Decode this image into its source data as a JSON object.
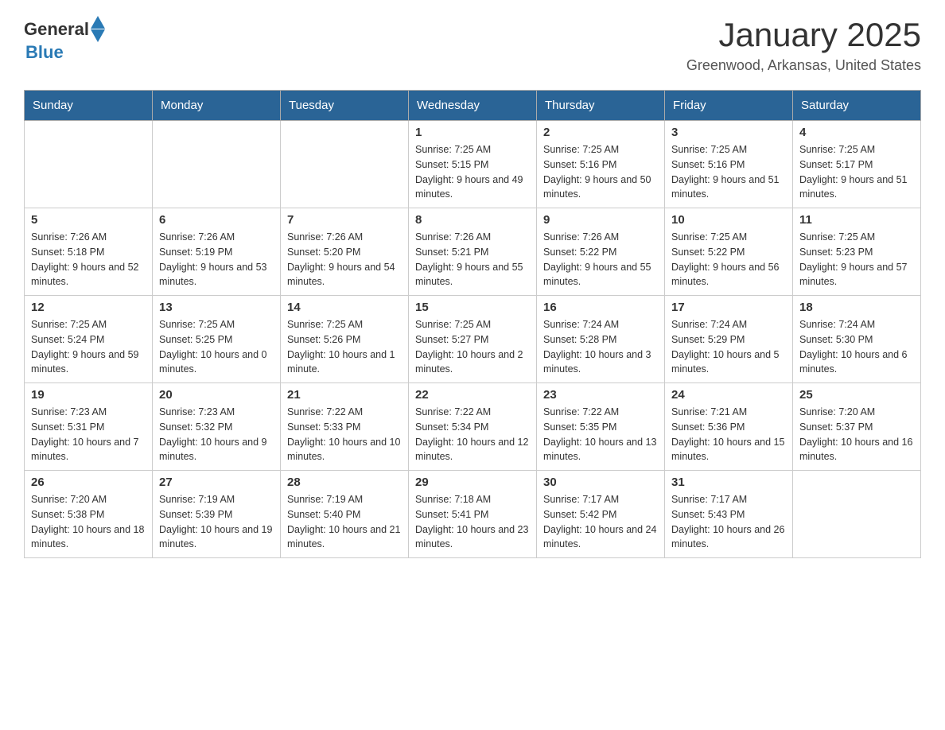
{
  "header": {
    "logo_general": "General",
    "logo_blue": "Blue",
    "title": "January 2025",
    "location": "Greenwood, Arkansas, United States"
  },
  "days_of_week": [
    "Sunday",
    "Monday",
    "Tuesday",
    "Wednesday",
    "Thursday",
    "Friday",
    "Saturday"
  ],
  "weeks": [
    [
      {
        "day": "",
        "info": ""
      },
      {
        "day": "",
        "info": ""
      },
      {
        "day": "",
        "info": ""
      },
      {
        "day": "1",
        "info": "Sunrise: 7:25 AM\nSunset: 5:15 PM\nDaylight: 9 hours and 49 minutes."
      },
      {
        "day": "2",
        "info": "Sunrise: 7:25 AM\nSunset: 5:16 PM\nDaylight: 9 hours and 50 minutes."
      },
      {
        "day": "3",
        "info": "Sunrise: 7:25 AM\nSunset: 5:16 PM\nDaylight: 9 hours and 51 minutes."
      },
      {
        "day": "4",
        "info": "Sunrise: 7:25 AM\nSunset: 5:17 PM\nDaylight: 9 hours and 51 minutes."
      }
    ],
    [
      {
        "day": "5",
        "info": "Sunrise: 7:26 AM\nSunset: 5:18 PM\nDaylight: 9 hours and 52 minutes."
      },
      {
        "day": "6",
        "info": "Sunrise: 7:26 AM\nSunset: 5:19 PM\nDaylight: 9 hours and 53 minutes."
      },
      {
        "day": "7",
        "info": "Sunrise: 7:26 AM\nSunset: 5:20 PM\nDaylight: 9 hours and 54 minutes."
      },
      {
        "day": "8",
        "info": "Sunrise: 7:26 AM\nSunset: 5:21 PM\nDaylight: 9 hours and 55 minutes."
      },
      {
        "day": "9",
        "info": "Sunrise: 7:26 AM\nSunset: 5:22 PM\nDaylight: 9 hours and 55 minutes."
      },
      {
        "day": "10",
        "info": "Sunrise: 7:25 AM\nSunset: 5:22 PM\nDaylight: 9 hours and 56 minutes."
      },
      {
        "day": "11",
        "info": "Sunrise: 7:25 AM\nSunset: 5:23 PM\nDaylight: 9 hours and 57 minutes."
      }
    ],
    [
      {
        "day": "12",
        "info": "Sunrise: 7:25 AM\nSunset: 5:24 PM\nDaylight: 9 hours and 59 minutes."
      },
      {
        "day": "13",
        "info": "Sunrise: 7:25 AM\nSunset: 5:25 PM\nDaylight: 10 hours and 0 minutes."
      },
      {
        "day": "14",
        "info": "Sunrise: 7:25 AM\nSunset: 5:26 PM\nDaylight: 10 hours and 1 minute."
      },
      {
        "day": "15",
        "info": "Sunrise: 7:25 AM\nSunset: 5:27 PM\nDaylight: 10 hours and 2 minutes."
      },
      {
        "day": "16",
        "info": "Sunrise: 7:24 AM\nSunset: 5:28 PM\nDaylight: 10 hours and 3 minutes."
      },
      {
        "day": "17",
        "info": "Sunrise: 7:24 AM\nSunset: 5:29 PM\nDaylight: 10 hours and 5 minutes."
      },
      {
        "day": "18",
        "info": "Sunrise: 7:24 AM\nSunset: 5:30 PM\nDaylight: 10 hours and 6 minutes."
      }
    ],
    [
      {
        "day": "19",
        "info": "Sunrise: 7:23 AM\nSunset: 5:31 PM\nDaylight: 10 hours and 7 minutes."
      },
      {
        "day": "20",
        "info": "Sunrise: 7:23 AM\nSunset: 5:32 PM\nDaylight: 10 hours and 9 minutes."
      },
      {
        "day": "21",
        "info": "Sunrise: 7:22 AM\nSunset: 5:33 PM\nDaylight: 10 hours and 10 minutes."
      },
      {
        "day": "22",
        "info": "Sunrise: 7:22 AM\nSunset: 5:34 PM\nDaylight: 10 hours and 12 minutes."
      },
      {
        "day": "23",
        "info": "Sunrise: 7:22 AM\nSunset: 5:35 PM\nDaylight: 10 hours and 13 minutes."
      },
      {
        "day": "24",
        "info": "Sunrise: 7:21 AM\nSunset: 5:36 PM\nDaylight: 10 hours and 15 minutes."
      },
      {
        "day": "25",
        "info": "Sunrise: 7:20 AM\nSunset: 5:37 PM\nDaylight: 10 hours and 16 minutes."
      }
    ],
    [
      {
        "day": "26",
        "info": "Sunrise: 7:20 AM\nSunset: 5:38 PM\nDaylight: 10 hours and 18 minutes."
      },
      {
        "day": "27",
        "info": "Sunrise: 7:19 AM\nSunset: 5:39 PM\nDaylight: 10 hours and 19 minutes."
      },
      {
        "day": "28",
        "info": "Sunrise: 7:19 AM\nSunset: 5:40 PM\nDaylight: 10 hours and 21 minutes."
      },
      {
        "day": "29",
        "info": "Sunrise: 7:18 AM\nSunset: 5:41 PM\nDaylight: 10 hours and 23 minutes."
      },
      {
        "day": "30",
        "info": "Sunrise: 7:17 AM\nSunset: 5:42 PM\nDaylight: 10 hours and 24 minutes."
      },
      {
        "day": "31",
        "info": "Sunrise: 7:17 AM\nSunset: 5:43 PM\nDaylight: 10 hours and 26 minutes."
      },
      {
        "day": "",
        "info": ""
      }
    ]
  ]
}
